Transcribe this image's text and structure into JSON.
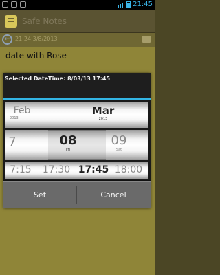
{
  "status_bar": {
    "time": "21:45",
    "icons": [
      "alarm-icon",
      "settings-icon",
      "usb-icon"
    ]
  },
  "app": {
    "title": "Safe Notes"
  },
  "note": {
    "date_label": "21:24 3/8/2013",
    "text": "date with Rose"
  },
  "dialog": {
    "title": "Selected DateTime: 8/03/13 17:45",
    "month_wheel": {
      "items": [
        {
          "value": "Feb",
          "sub": "2013"
        },
        {
          "value": "Mar",
          "sub": "2013"
        }
      ],
      "selected": "Mar"
    },
    "day_wheel": {
      "items": [
        {
          "value": "7",
          "sub": ""
        },
        {
          "value": "08",
          "sub": "Fri"
        },
        {
          "value": "09",
          "sub": "Sat"
        }
      ],
      "selected": "08"
    },
    "time_wheel": {
      "items": [
        "7:15",
        "17:30",
        "17:45",
        "18:00"
      ],
      "selected": "17:45"
    },
    "buttons": {
      "set": "Set",
      "cancel": "Cancel"
    }
  }
}
